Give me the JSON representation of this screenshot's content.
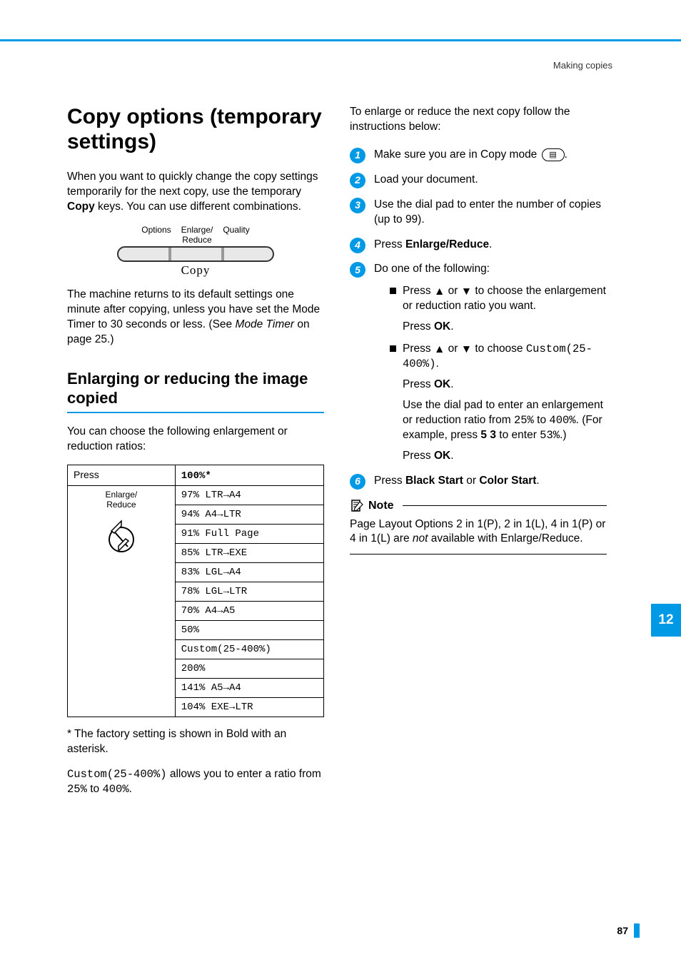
{
  "breadcrumb": "Making copies",
  "heading_main": "Copy options (temporary settings)",
  "intro1_a": "When you want to quickly change the copy settings temporarily for the next copy, use the temporary ",
  "intro1_b": "Copy",
  "intro1_c": " keys. You can use different combinations.",
  "keys": {
    "label_options": "Options",
    "label_enlarge_reduce_line1": "Enlarge/",
    "label_enlarge_reduce_line2": "Reduce",
    "label_quality": "Quality",
    "label_copy": "Copy"
  },
  "intro2_a": "The machine returns to its default settings one minute after copying, unless you have set the Mode Timer to 30 seconds or less. (See ",
  "intro2_b": "Mode Timer",
  "intro2_c": " on page 25.)",
  "heading_sub": "Enlarging or reducing the image copied",
  "ratios_intro": "You can choose the following enlargement or reduction ratios:",
  "table": {
    "head_press": "Press",
    "press_label_line1": "Enlarge/",
    "press_label_line2": "Reduce",
    "head_default": "100%*",
    "rows": [
      "97% LTR→A4",
      "94% A4→LTR",
      "91% Full Page",
      "85% LTR→EXE",
      "83% LGL→A4",
      "78% LGL→LTR",
      "70% A4→A5",
      "50%",
      "Custom(25-400%)",
      "200%",
      "141% A5→A4",
      "104% EXE→LTR"
    ]
  },
  "footnote": "* The factory setting is shown in Bold with an asterisk.",
  "custom_a": "Custom(25-400%)",
  "custom_b": " allows you to enter a ratio from ",
  "custom_c": "25%",
  "custom_d": " to ",
  "custom_e": "400%",
  "custom_f": ".",
  "right_intro": "To enlarge or reduce the next copy follow the instructions below:",
  "steps": {
    "s1": "Make sure you are in Copy mode ",
    "s1_end": ".",
    "s2": "Load your document.",
    "s3": "Use the dial pad to enter the number of copies (up to 99).",
    "s4_a": "Press ",
    "s4_b": "Enlarge/Reduce",
    "s4_c": ".",
    "s5": "Do one of the following:",
    "s5a_a": "Press ",
    "s5a_b": " or ",
    "s5a_c": " to choose the enlargement or reduction ratio you want.",
    "s5a_ok_a": "Press ",
    "s5a_ok_b": "OK",
    "s5a_ok_c": ".",
    "s5b_a": "Press ",
    "s5b_b": " or ",
    "s5b_c": " to choose ",
    "s5b_d": "Custom(25-400%)",
    "s5b_e": ".",
    "s5b_dial_a": "Use the dial pad to enter an enlargement or reduction ratio from ",
    "s5b_dial_b": "25%",
    "s5b_dial_c": " to ",
    "s5b_dial_d": "400%",
    "s5b_dial_e": ". (For example, press ",
    "s5b_dial_f": "5 3",
    "s5b_dial_g": " to enter ",
    "s5b_dial_h": "53%",
    "s5b_dial_i": ".)",
    "s6_a": "Press ",
    "s6_b": "Black Start",
    "s6_c": " or ",
    "s6_d": "Color Start",
    "s6_e": "."
  },
  "note": {
    "label": "Note",
    "body_a": "Page Layout Options 2 in 1(P), 2 in 1(L), 4 in 1(P) or 4 in 1(L) are ",
    "body_b": "not",
    "body_c": " available with Enlarge/Reduce."
  },
  "side_tab": "12",
  "page_num": "87",
  "arrow_up": "▲",
  "arrow_down": "▼",
  "copy_icon_glyph": "▤"
}
